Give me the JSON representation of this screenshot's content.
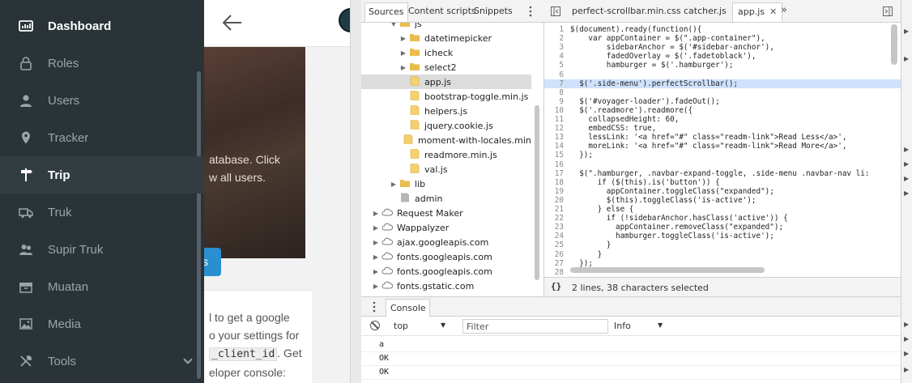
{
  "app": {
    "sidebar": {
      "items": [
        {
          "label": "Dashboard",
          "icon": "dashboard-icon"
        },
        {
          "label": "Roles",
          "icon": "lock-icon"
        },
        {
          "label": "Users",
          "icon": "user-icon"
        },
        {
          "label": "Tracker",
          "icon": "map-pin-icon"
        },
        {
          "label": "Trip",
          "icon": "signpost-icon"
        },
        {
          "label": "Truk",
          "icon": "truck-icon"
        },
        {
          "label": "Supir Truk",
          "icon": "users-icon"
        },
        {
          "label": "Muatan",
          "icon": "box-icon"
        },
        {
          "label": "Media",
          "icon": "image-icon"
        },
        {
          "label": "Tools",
          "icon": "tools-icon"
        }
      ]
    },
    "hero": {
      "text_line1": "atabase. Click",
      "text_line2": "w all users.",
      "button_label": "s"
    },
    "card": {
      "line1": "l to get a google",
      "line2": "o your settings for",
      "code": "_client_id",
      "line3_suffix": ". Get",
      "line4": "eloper console:"
    }
  },
  "devtools": {
    "navigator_tabs": [
      "Sources",
      "Content scripts",
      "Snippets"
    ],
    "tree": [
      {
        "label": "js",
        "depth": 1,
        "type": "folder",
        "expanded": true
      },
      {
        "label": "datetimepicker",
        "depth": 2,
        "type": "folder"
      },
      {
        "label": "icheck",
        "depth": 2,
        "type": "folder"
      },
      {
        "label": "select2",
        "depth": 2,
        "type": "folder"
      },
      {
        "label": "app.js",
        "depth": 2,
        "type": "file",
        "selected": true
      },
      {
        "label": "bootstrap-toggle.min.js",
        "depth": 2,
        "type": "file"
      },
      {
        "label": "helpers.js",
        "depth": 2,
        "type": "file"
      },
      {
        "label": "jquery.cookie.js",
        "depth": 2,
        "type": "file"
      },
      {
        "label": "moment-with-locales.min.js",
        "depth": 2,
        "type": "file"
      },
      {
        "label": "readmore.min.js",
        "depth": 2,
        "type": "file"
      },
      {
        "label": "val.js",
        "depth": 2,
        "type": "file"
      },
      {
        "label": "lib",
        "depth": 1,
        "type": "folder"
      },
      {
        "label": "admin",
        "depth": 1,
        "type": "file-gray"
      },
      {
        "label": "Request Maker",
        "depth": 0,
        "type": "cloud"
      },
      {
        "label": "Wappalyzer",
        "depth": 0,
        "type": "cloud"
      },
      {
        "label": "ajax.googleapis.com",
        "depth": 0,
        "type": "cloud"
      },
      {
        "label": "fonts.googleapis.com",
        "depth": 0,
        "type": "cloud"
      },
      {
        "label": "fonts.googleapis.com",
        "depth": 0,
        "type": "cloud"
      },
      {
        "label": "fonts.gstatic.com",
        "depth": 0,
        "type": "cloud"
      }
    ],
    "editor_tabs": [
      {
        "label": "perfect-scrollbar.min.css",
        "active": false
      },
      {
        "label": "catcher.js",
        "active": false
      },
      {
        "label": "app.js",
        "active": true
      }
    ],
    "code_lines": [
      {
        "n": "1",
        "text": "$(document).ready(function(){"
      },
      {
        "n": "2",
        "text": "    var appContainer = $(\".app-container\"),"
      },
      {
        "n": "3",
        "text": "        sidebarAnchor = $('#sidebar-anchor'),"
      },
      {
        "n": "4",
        "text": "        fadedOverlay = $('.fadetoblack'),"
      },
      {
        "n": "5",
        "text": "        hamburger = $('.hamburger');"
      },
      {
        "n": "6",
        "text": ""
      },
      {
        "n": "7",
        "text": "  $('.side-menu').perfectScrollbar();",
        "highlight": true
      },
      {
        "n": "8",
        "text": ""
      },
      {
        "n": "9",
        "text": "  $('#voyager-loader').fadeOut();"
      },
      {
        "n": "10",
        "text": "  $('.readmore').readmore({"
      },
      {
        "n": "11",
        "text": "    collapsedHeight: 60,"
      },
      {
        "n": "12",
        "text": "    embedCSS: true,"
      },
      {
        "n": "13",
        "text": "    lessLink: '<a href=\"#\" class=\"readm-link\">Read Less</a>',"
      },
      {
        "n": "14",
        "text": "    moreLink: '<a href=\"#\" class=\"readm-link\">Read More</a>',"
      },
      {
        "n": "15",
        "text": "  });"
      },
      {
        "n": "16",
        "text": ""
      },
      {
        "n": "17",
        "text": "  $(\".hamburger, .navbar-expand-toggle, .side-menu .navbar-nav li:"
      },
      {
        "n": "18",
        "text": "      if ($(this).is('button')) {"
      },
      {
        "n": "19",
        "text": "        appContainer.toggleClass(\"expanded\");"
      },
      {
        "n": "20",
        "text": "        $(this).toggleClass('is-active');"
      },
      {
        "n": "21",
        "text": "      } else {"
      },
      {
        "n": "22",
        "text": "        if (!sidebarAnchor.hasClass('active')) {"
      },
      {
        "n": "23",
        "text": "          appContainer.removeClass(\"expanded\");"
      },
      {
        "n": "24",
        "text": "          hamburger.toggleClass('is-active');"
      },
      {
        "n": "25",
        "text": "        }"
      },
      {
        "n": "26",
        "text": "      }"
      },
      {
        "n": "27",
        "text": "  });"
      },
      {
        "n": "28",
        "text": ""
      }
    ],
    "status_icon": "{}",
    "status_text": "2 lines, 38 characters selected",
    "console": {
      "tab_label": "Console",
      "context": "top",
      "filter_placeholder": "Filter",
      "level": "Info",
      "lines": [
        "a",
        "OK",
        "OK"
      ]
    }
  }
}
